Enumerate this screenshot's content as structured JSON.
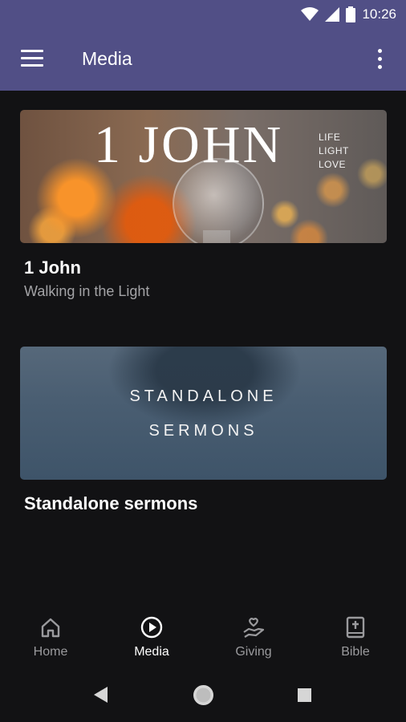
{
  "status_bar": {
    "time": "10:26"
  },
  "app_bar": {
    "title": "Media"
  },
  "series": [
    {
      "title": "1 John",
      "subtitle": "Walking in the Light",
      "image_title": "1 JOHN",
      "image_side_lines": [
        "LIFE",
        "LIGHT",
        "LOVE"
      ]
    },
    {
      "title": "Standalone sermons",
      "image_lines": [
        "STANDALONE",
        "SERMONS"
      ]
    }
  ],
  "bottom_nav": [
    {
      "label": "Home",
      "icon": "home-icon"
    },
    {
      "label": "Media",
      "icon": "play-circle-icon",
      "active": true
    },
    {
      "label": "Giving",
      "icon": "giving-hand-heart-icon"
    },
    {
      "label": "Bible",
      "icon": "bible-icon"
    }
  ],
  "colors": {
    "app_bar": "#514f86",
    "background": "#121214",
    "inactive_nav": "#9a9a9d"
  }
}
